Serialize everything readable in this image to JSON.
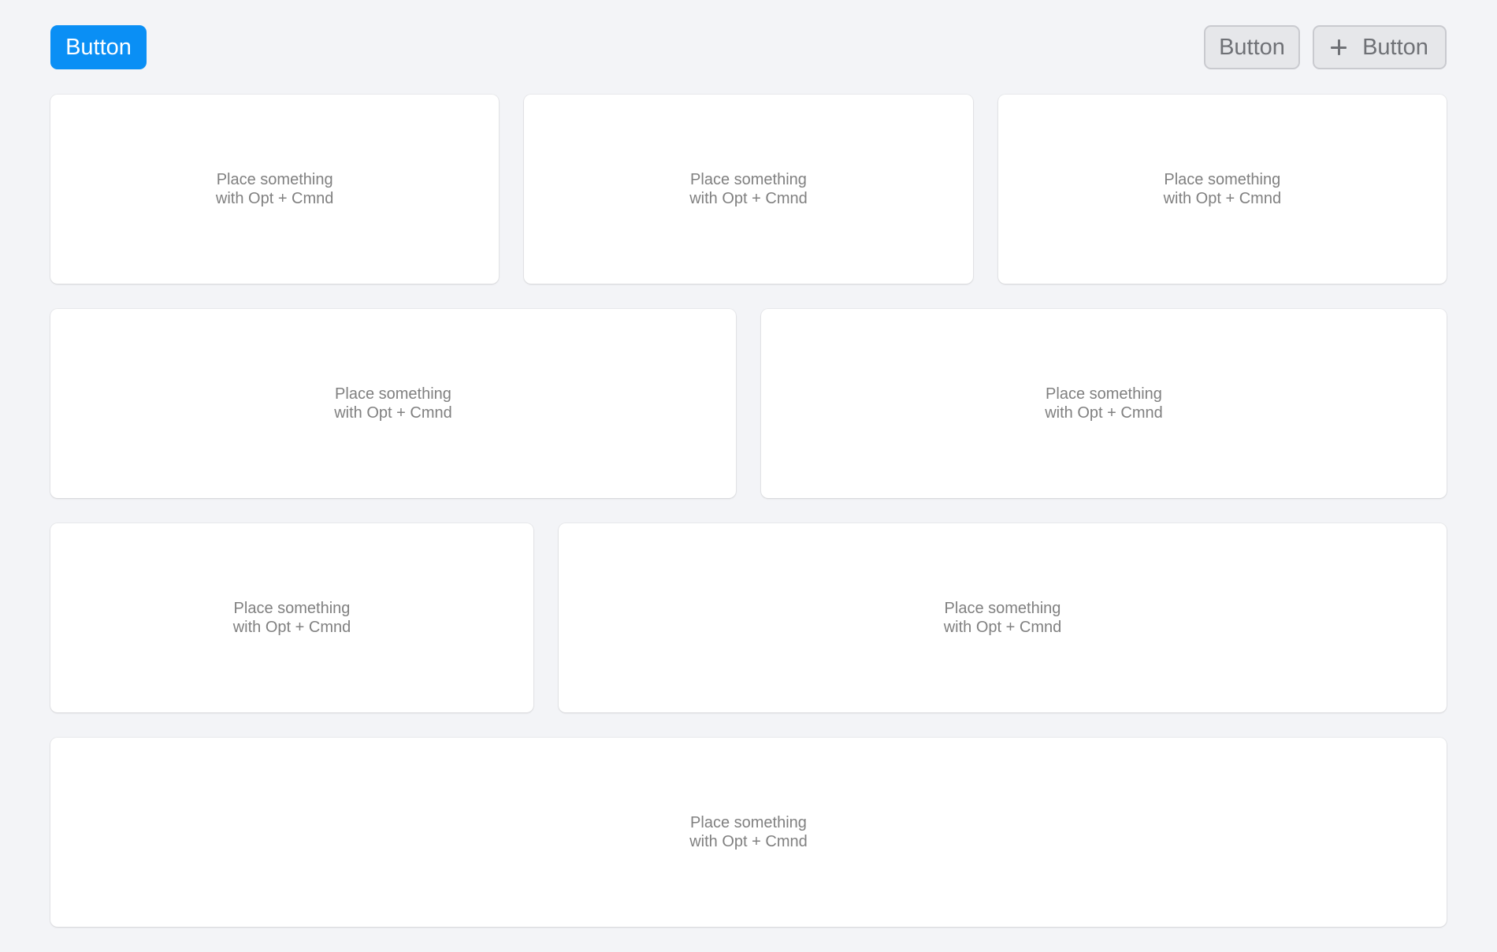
{
  "toolbar": {
    "primary_label": "Button",
    "secondary_label": "Button",
    "add_label": "Button"
  },
  "cards": {
    "line1": "Place something",
    "line2": "with Opt + Cmnd"
  },
  "colors": {
    "accent": "#0a8ff5",
    "background": "#f3f4f7",
    "card": "#ffffff",
    "placeholder_text": "#808080"
  },
  "icons": {
    "add_button_icon": "plus-icon"
  }
}
